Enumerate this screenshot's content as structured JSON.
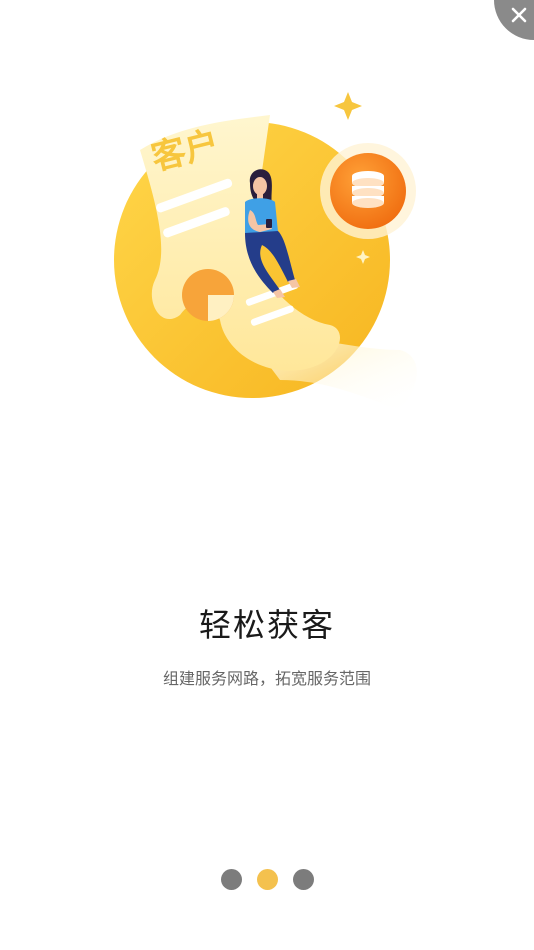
{
  "illustration": {
    "badge_text": "客户",
    "icon": "customer-coins-illustration"
  },
  "title": "轻松获客",
  "subtitle": "组建服务网路，拓宽服务范围",
  "pager": {
    "count": 3,
    "active_index": 1
  },
  "colors": {
    "accent_yellow": "#f4c14e",
    "coin_orange": "#f5821f",
    "dot_inactive": "#7c7c7c",
    "close_bg": "#8a8a8a"
  },
  "close_icon": "close-icon"
}
